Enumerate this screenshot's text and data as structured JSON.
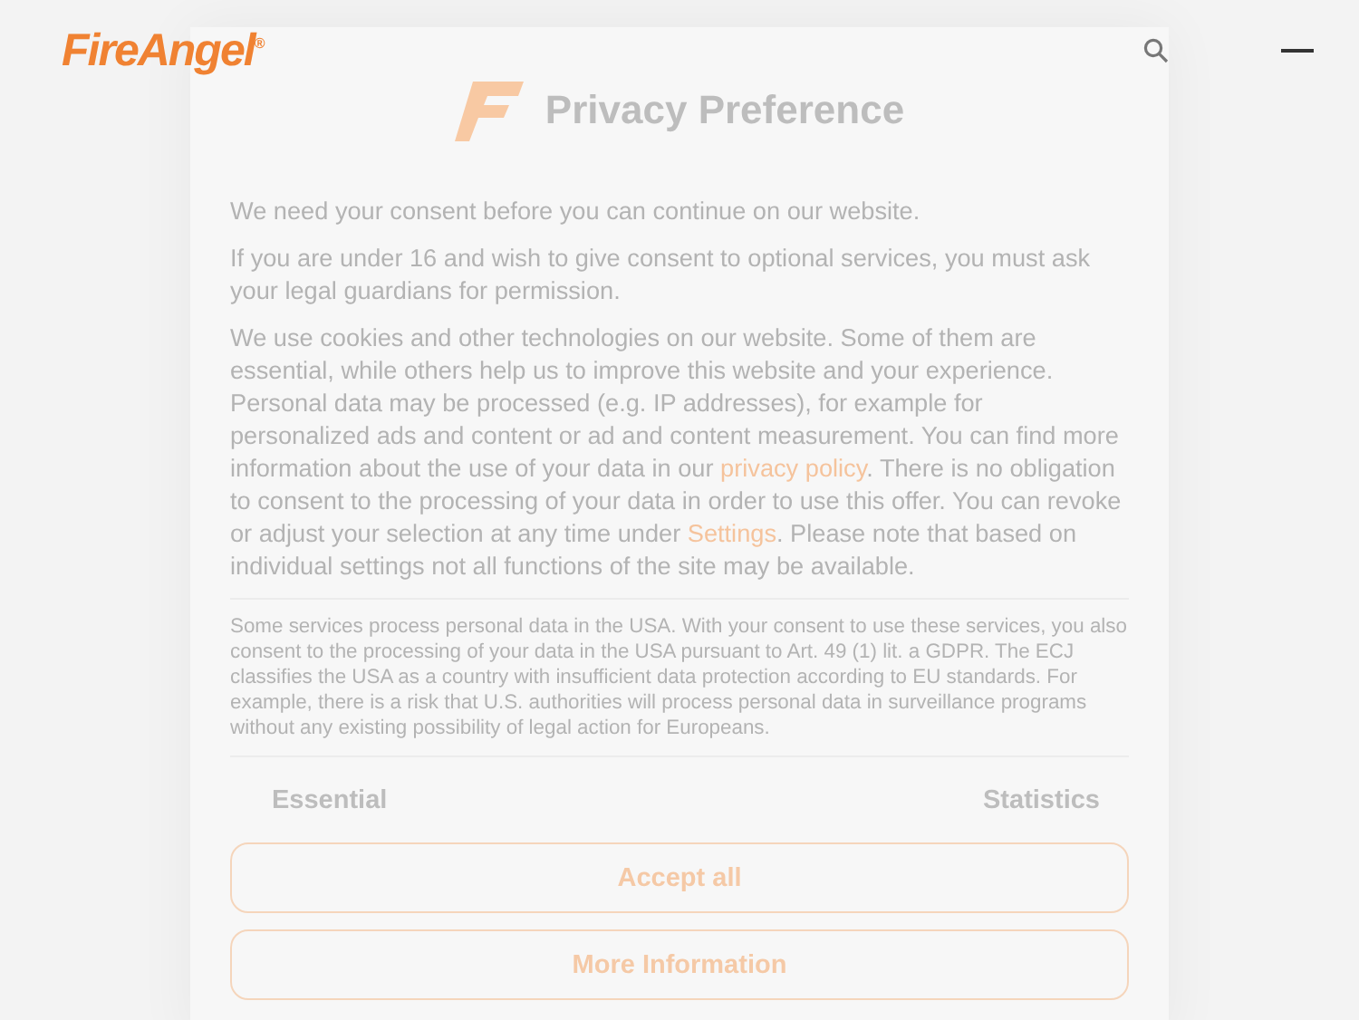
{
  "header": {
    "logo": "FireAngel$^{®}$"
  },
  "dialog": {
    "title": "Privacy Preference",
    "paragraphs": [
      [
        {
          "kind": "text",
          "text": "We need your consent before you can continue on our website."
        }
      ],
      [
        {
          "kind": "text",
          "text": "If you are under 16 and wish to give consent to optional services, you must ask your legal guardians for permission."
        }
      ],
      [
        {
          "kind": "text",
          "text": "We use cookies and other technologies on our website. Some of them are essential, while others help us to improve this website and your experience. Personal data may be processed (e.g. IP addresses), for example for personalized ads and content or ad and content measurement. You can find more information about the use of your data in our "
        },
        {
          "kind": "link",
          "text": "privacy policy"
        },
        {
          "kind": "text",
          "text": ". There is no obligation to consent to the processing of your data in order to use this offer. You can revoke or adjust your selection at any time under "
        },
        {
          "kind": "link",
          "text": "Settings"
        },
        {
          "kind": "text",
          "text": ". Please note that based on individual settings not all functions of the site may be available."
        }
      ]
    ],
    "notice": "Some services process personal data in the USA. With your consent to use these services, you also consent to the processing of your data in the USA pursuant to Art. 49 (1) lit. a GDPR. The ECJ classifies the USA as a country with insufficient data protection according to EU standards. For example, there is a risk that U.S. authorities will process personal data in surveillance programs without any existing possibility of legal action for Europeans.",
    "categories": [
      "Essential",
      "Statistics"
    ],
    "buttons": [
      "Accept all",
      "More Information"
    ]
  }
}
